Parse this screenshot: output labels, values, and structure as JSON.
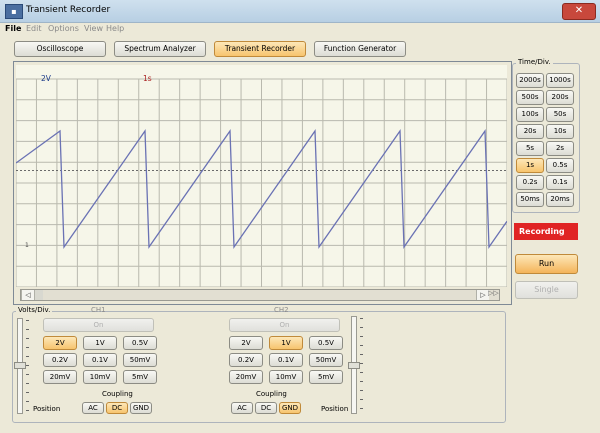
{
  "window": {
    "title": "Transient Recorder",
    "close_glyph": "✕"
  },
  "menu": [
    "File",
    "Edit",
    "Options",
    "View",
    "Help"
  ],
  "tabs": [
    {
      "label": "Oscilloscope",
      "active": false
    },
    {
      "label": "Spectrum Analyzer",
      "active": false
    },
    {
      "label": "Transient Recorder",
      "active": true
    },
    {
      "label": "Function Generator",
      "active": false
    }
  ],
  "scope": {
    "volts_readout": "2V",
    "time_readout": "1s",
    "marker": "1",
    "trace_color": "#6a72b4",
    "grid_color": "#b9b9ae",
    "background": "#f6f6e9",
    "signal": {
      "shape": "sawtooth",
      "cycles_visible": 5,
      "direction": "ramp up, sharp fall"
    }
  },
  "scroll": {
    "left_icon": "◁",
    "right_icon": "▷",
    "far_right_icon": "▷▷"
  },
  "time_div": {
    "title": "Time/Div.",
    "rows": [
      [
        "2000s",
        "1000s"
      ],
      [
        "500s",
        "200s"
      ],
      [
        "100s",
        "50s"
      ],
      [
        "20s",
        "10s"
      ],
      [
        "5s",
        "2s"
      ],
      [
        "1s",
        "0.5s"
      ],
      [
        "0.2s",
        "0.1s"
      ],
      [
        "50ms",
        "20ms"
      ]
    ],
    "selected": "1s"
  },
  "status": {
    "recording": "Recording",
    "run": "Run",
    "single": "Single"
  },
  "volts_div": {
    "title": "Volts/Div.",
    "ch1": {
      "title": "CH1",
      "toggle": "On",
      "selected": "2V",
      "coupling_selected": "DC"
    },
    "ch2": {
      "title": "CH2",
      "toggle": "On",
      "selected": "1V",
      "coupling_selected": "GND"
    },
    "rows": [
      [
        "2V",
        "1V",
        "0.5V"
      ],
      [
        "0.2V",
        "0.1V",
        "50mV"
      ],
      [
        "20mV",
        "10mV",
        "5mV"
      ]
    ],
    "coupling_label": "Coupling",
    "coupling_options": [
      "AC",
      "DC",
      "GND"
    ],
    "position_label": "Position"
  }
}
